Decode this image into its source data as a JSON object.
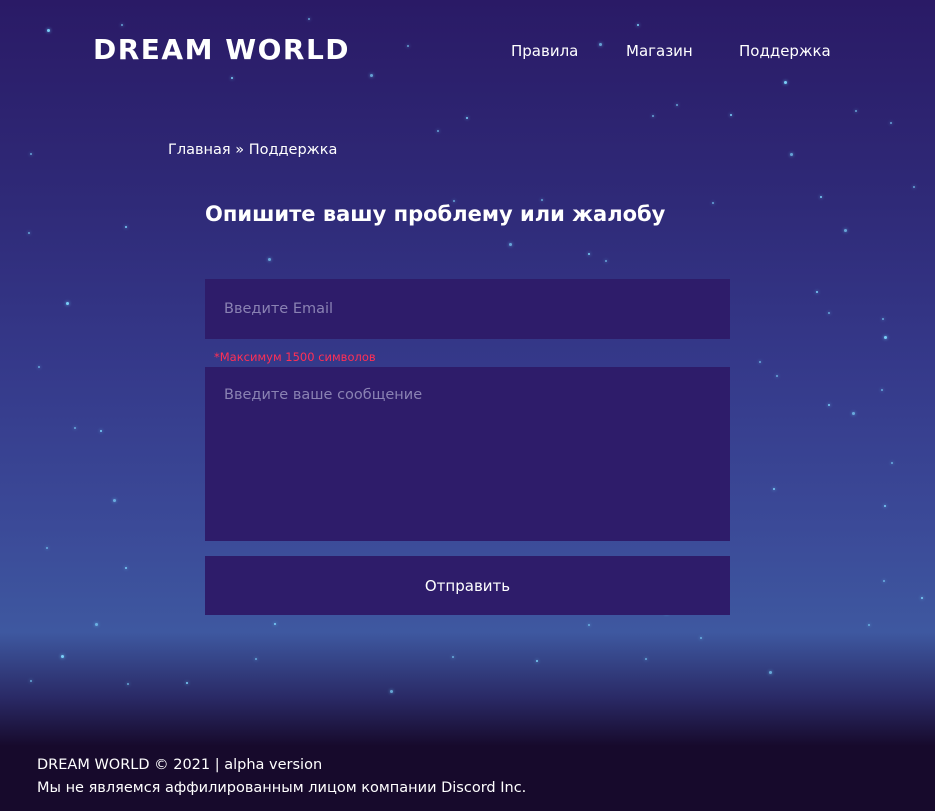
{
  "header": {
    "logo": "DREAM WORLD",
    "nav": [
      "Правила",
      "Магазин",
      "Поддержка"
    ]
  },
  "breadcrumb": {
    "home": "Главная",
    "separator": " » ",
    "current": "Поддержка"
  },
  "form": {
    "title": "Опишите вашу проблему или жалобу",
    "email_placeholder": "Введите Email",
    "email_value": "",
    "limit_hint": "*Максимум 1500 символов",
    "message_placeholder": "Введите ваше сообщение",
    "message_value": "",
    "submit_label": "Отправить"
  },
  "footer": {
    "copyright": "DREAM WORLD © 2021 | alpha version",
    "disclaimer": "Мы не являемся аффилированным лицом компании Discord Inc."
  },
  "colors": {
    "field_bg": "#2e1c6a",
    "hint": "#ff2f55",
    "star": "#7fd8ff"
  }
}
